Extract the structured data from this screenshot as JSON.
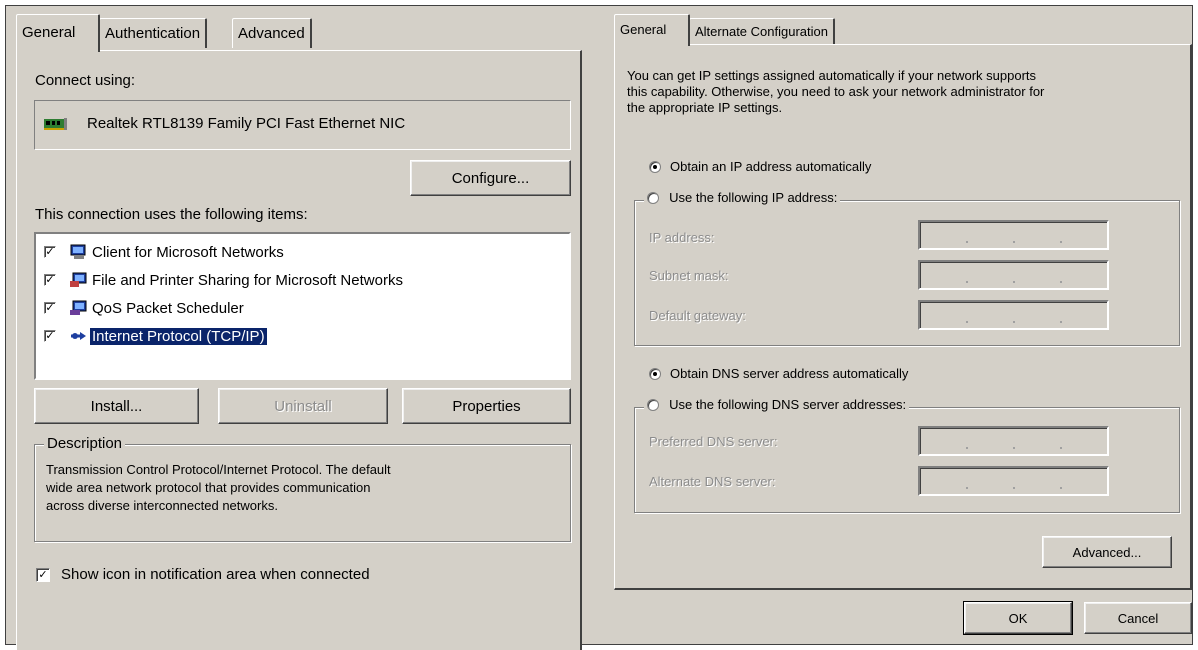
{
  "left_dialog": {
    "tabs": [
      "General",
      "Authentication",
      "Advanced"
    ],
    "connect_using_label": "Connect using:",
    "adapter_name": "Realtek RTL8139 Family PCI Fast Ethernet NIC",
    "configure_label": "Configure...",
    "items_label": "This connection uses the following items:",
    "items": [
      {
        "label": "Client for Microsoft Networks",
        "checked": true,
        "icon": "network-client-icon"
      },
      {
        "label": "File and Printer Sharing for Microsoft Networks",
        "checked": true,
        "icon": "file-sharing-icon"
      },
      {
        "label": "QoS Packet Scheduler",
        "checked": true,
        "icon": "qos-scheduler-icon"
      },
      {
        "label": "Internet Protocol (TCP/IP)",
        "checked": true,
        "icon": "tcpip-protocol-icon",
        "selected": true
      }
    ],
    "install_label": "Install...",
    "uninstall_label": "Uninstall",
    "properties_label": "Properties",
    "description_title": "Description",
    "description_lines": [
      "Transmission Control Protocol/Internet Protocol. The default",
      "wide area network protocol that provides communication",
      "across diverse interconnected networks."
    ],
    "show_icon_label": "Show icon in notification area when connected",
    "show_icon_checked": true
  },
  "right_dialog": {
    "tabs": [
      "General",
      "Alternate Configuration"
    ],
    "intro_lines": [
      "You can get IP settings assigned automatically if your network supports",
      "this capability. Otherwise, you need to ask your network administrator for",
      "the appropriate IP settings."
    ],
    "ip_auto_label": "Obtain an IP address automatically",
    "ip_manual_label": "Use the following IP address:",
    "ip_mode": "automatic",
    "ip_address_label": "IP address:",
    "subnet_mask_label": "Subnet mask:",
    "default_gateway_label": "Default gateway:",
    "dns_auto_label": "Obtain DNS server address automatically",
    "dns_manual_label": "Use the following DNS server addresses:",
    "dns_mode": "automatic",
    "preferred_dns_label": "Preferred DNS server:",
    "alternate_dns_label": "Alternate DNS server:",
    "advanced_label": "Advanced...",
    "ok_label": "OK",
    "cancel_label": "Cancel"
  },
  "colors": {
    "face": "#d4d0c8",
    "selection": "#0a246a",
    "disabled_text": "#8c8c8c"
  }
}
